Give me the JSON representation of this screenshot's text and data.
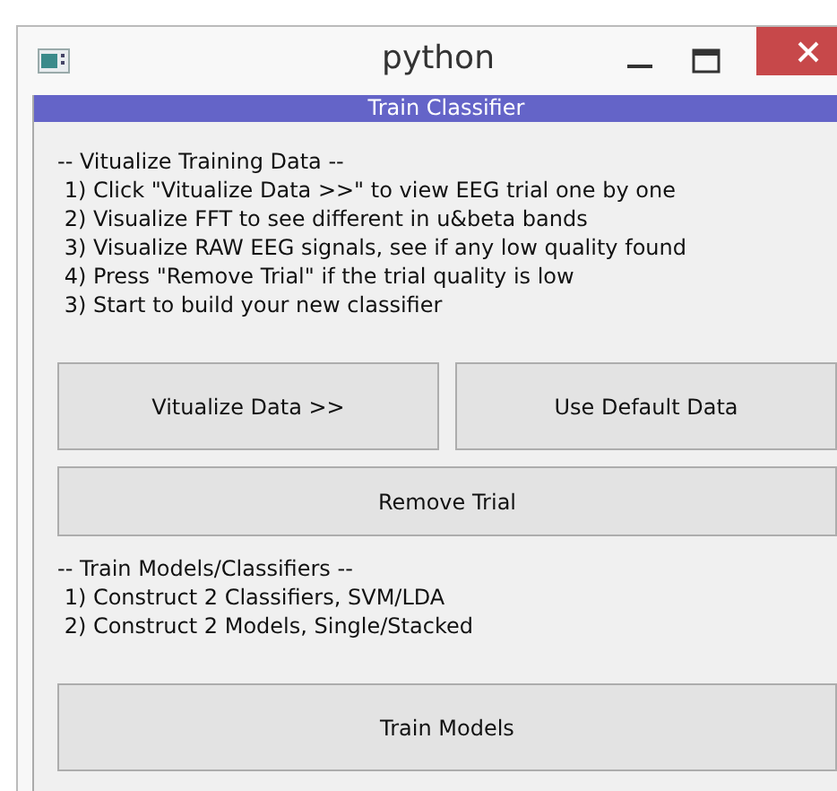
{
  "window": {
    "title": "python"
  },
  "banner": "Train Classifier",
  "instructions": [
    "-- Vitualize Training Data --",
    " 1) Click \"Vitualize Data >>\" to view EEG trial one by one",
    " 2) Visualize FFT to see different in u&beta bands",
    " 3) Visualize RAW EEG signals, see if any low quality found",
    " 4) Press \"Remove Trial\" if the trial quality is low",
    " 3) Start to build your new classifier"
  ],
  "buttons_row": [
    "Vitualize Data >>",
    "Use Default Data"
  ],
  "remove_button": "Remove Trial",
  "train_notes": [
    "-- Train Models/Classifiers --",
    " 1) Construct 2 Classifiers, SVM/LDA",
    " 2) Construct 2 Models, Single/Stacked"
  ],
  "train_button": "Train Models"
}
